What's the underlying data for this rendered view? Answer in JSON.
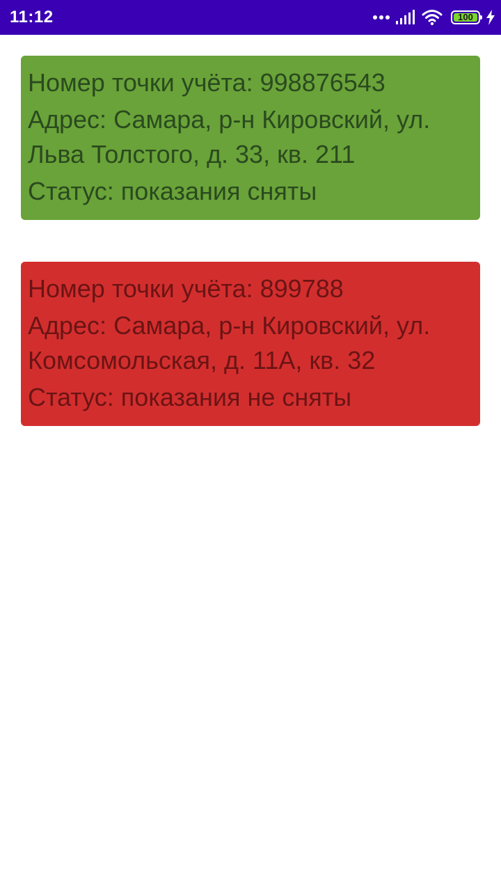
{
  "status_bar": {
    "time": "11:12",
    "battery": "100",
    "icons": [
      "dots-icon",
      "signal-icon",
      "wifi-icon",
      "battery-icon",
      "charging-icon"
    ],
    "background": "#3a00b4"
  },
  "cards": [
    {
      "number_line": "Номер точки учёта: 998876543",
      "address_line": "Адрес: Самара, р-н Кировский, ул. Льва Толстого, д. 33, кв. 211",
      "status_line": "Статус: показания сняты",
      "color": "#6aa339"
    },
    {
      "number_line": "Номер точки учёта: 899788",
      "address_line": "Адрес: Самара, р-н Кировский, ул. Комсомольская, д. 11А, кв. 32",
      "status_line": "Статус: показания не сняты",
      "color": "#d32e2e"
    }
  ]
}
